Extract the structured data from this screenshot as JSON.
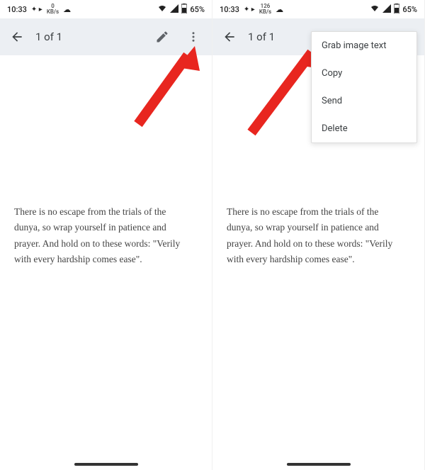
{
  "status": {
    "time": "10:33",
    "speed0": "0",
    "speed0_unit": "KB/s",
    "speed126": "126",
    "speed126_unit": "KB/s",
    "battery": "65%"
  },
  "appbar": {
    "counter": "1 of 1"
  },
  "note": {
    "text": "There is no escape from the trials of the dunya, so wrap yourself in patience and prayer. And hold on to these words: \"Verily with every hardship comes ease\"."
  },
  "menu": {
    "grab": "Grab image text",
    "copy": "Copy",
    "send": "Send",
    "delete": "Delete"
  }
}
